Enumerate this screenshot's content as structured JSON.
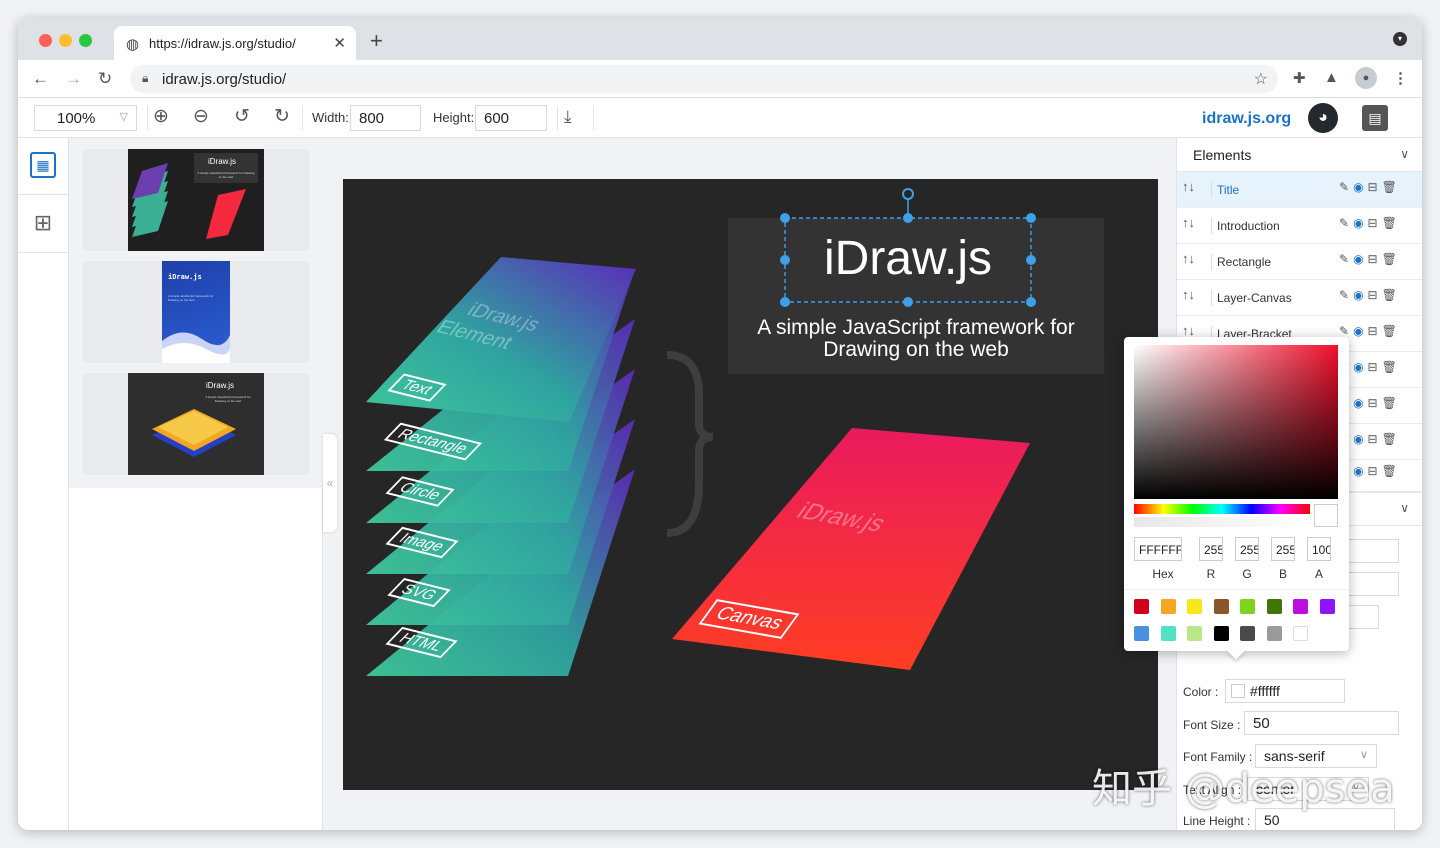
{
  "browser": {
    "tab_title": "https://idraw.js.org/studio/",
    "url": "idraw.js.org/studio/"
  },
  "toolbar": {
    "zoom": "100%",
    "width_label": "Width:",
    "width_value": "800",
    "height_label": "Height:",
    "height_value": "600",
    "brand": "idraw.js.org"
  },
  "thumbnails": [
    {
      "title": "iDraw.js",
      "subtitle": "A simple JavaScript framework for Drawing on the web"
    },
    {
      "title": "iDraw.js",
      "subtitle": "A simple JavaScript framework for Drawing on the web"
    },
    {
      "title": "iDraw.js",
      "subtitle": "A simple JavaScript framework for Drawing on the web"
    }
  ],
  "canvas": {
    "title": "iDraw.js",
    "subtitle_line1": "A simple JavaScript framework for",
    "subtitle_line2": "Drawing on the web",
    "layer_heading1": "iDraw.js",
    "layer_heading2": "Element",
    "layers": [
      "Text",
      "Rectangle",
      "Circle",
      "Image",
      "SVG",
      "HTML"
    ],
    "canvas_heading": "iDraw.js",
    "canvas_label": "Canvas"
  },
  "elements_panel": {
    "title": "Elements",
    "items": [
      {
        "label": "Title",
        "selected": true
      },
      {
        "label": "Introduction",
        "selected": false
      },
      {
        "label": "Rectangle",
        "selected": false
      },
      {
        "label": "Layer-Canvas",
        "selected": false
      },
      {
        "label": "Layer-Bracket",
        "selected": false
      }
    ]
  },
  "color_picker": {
    "hex": "FFFFFF",
    "r": "255",
    "g": "255",
    "b": "255",
    "a": "100",
    "hex_label": "Hex",
    "r_label": "R",
    "g_label": "G",
    "b_label": "B",
    "a_label": "A",
    "swatches": [
      "#d0021b",
      "#f5a623",
      "#f8e71c",
      "#8b572a",
      "#7ed321",
      "#417505",
      "#bd10e0",
      "#9013fe",
      "#4a90e2",
      "#50e3c2",
      "#b8e986",
      "#000000",
      "#4a4a4a",
      "#9b9b9b",
      "#ffffff"
    ]
  },
  "attributes": {
    "color_label": "Color :",
    "color_value": "#ffffff",
    "font_size_label": "Font Size :",
    "font_size_value": "50",
    "font_family_label": "Font Family :",
    "font_family_value": "sans-serif",
    "text_align_label": "Text Align :",
    "text_align_value": "center",
    "line_height_label": "Line Height :",
    "line_height_value": "50"
  },
  "watermark": "知乎 @deepsea"
}
